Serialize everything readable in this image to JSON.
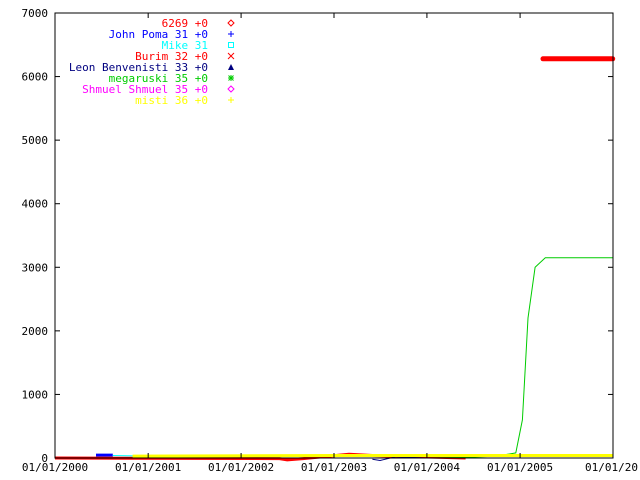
{
  "chart_data": {
    "type": "line",
    "title": "",
    "xlabel": "",
    "ylabel": "",
    "ylim": [
      0,
      7000
    ],
    "yticks": [
      0,
      1000,
      2000,
      3000,
      4000,
      5000,
      6000,
      7000
    ],
    "ytick_labels": [
      "0",
      "1000",
      "2000",
      "3000",
      "4000",
      "5000",
      "6000",
      "7000"
    ],
    "xlim": [
      "2000-01-01",
      "2006-01-01"
    ],
    "xticks": [
      "2000-01-01",
      "2001-01-01",
      "2002-01-01",
      "2003-01-01",
      "2004-01-01",
      "2005-01-01",
      "2006-01-01"
    ],
    "xtick_labels": [
      "01/01/2000",
      "01/01/2001",
      "01/01/2002",
      "01/01/2003",
      "01/01/2004",
      "01/01/2005",
      "01/01/20"
    ],
    "grid": false,
    "legend_position": "top-left",
    "series": [
      {
        "name": "6269",
        "legend_label": "6269 +0",
        "color": "#ff0000",
        "marker": "diamond",
        "x": [
          "2005-04-01",
          "2005-12-31"
        ],
        "y": [
          6280,
          6280
        ]
      },
      {
        "name": "John Poma",
        "legend_label": "John Poma 31 +0",
        "color": "#0000ff",
        "marker": "plus",
        "x": [
          "2000-06-10",
          "2000-08-15"
        ],
        "y": [
          45,
          45
        ]
      },
      {
        "name": "Mike",
        "legend_label": "Mike 31",
        "color": "#00ffff",
        "marker": "square",
        "x": [
          "2000-08-15",
          "2000-10-15",
          "2001-01-01"
        ],
        "y": [
          40,
          35,
          30
        ]
      },
      {
        "name": "Burim",
        "legend_label": "Burim 32 +0",
        "color": "#ff0000",
        "marker": "cross",
        "x": [
          "2000-01-01",
          "2002-06-01",
          "2002-07-01",
          "2002-09-01",
          "2003-03-01",
          "2003-06-01",
          "2004-06-01"
        ],
        "y": [
          0,
          -10,
          -30,
          -10,
          60,
          40,
          0
        ]
      },
      {
        "name": "Leon Benvenisti",
        "legend_label": "Leon Benvenisti 33 +0",
        "color": "#000080",
        "marker": "triangle",
        "x": [
          "2003-06-01",
          "2003-07-01",
          "2003-09-01",
          "2003-12-31"
        ],
        "y": [
          -20,
          -40,
          20,
          0
        ]
      },
      {
        "name": "megaruski",
        "legend_label": "megaruski 35 +0",
        "color": "#00cc00",
        "marker": "asterisk",
        "x": [
          "2001-01-01",
          "2004-01-01",
          "2004-06-01",
          "2004-10-01",
          "2004-12-15",
          "2005-01-10",
          "2005-02-01",
          "2005-03-01",
          "2005-04-10",
          "2005-12-31"
        ],
        "y": [
          0,
          0,
          10,
          30,
          80,
          600,
          2200,
          3000,
          3150,
          3150
        ]
      },
      {
        "name": "Shmuel Shmuel",
        "legend_label": "Shmuel Shmuel 35 +0",
        "color": "#ff00ff",
        "marker": "diamond-open",
        "x": [
          "2000-01-01",
          "2001-06-01"
        ],
        "y": [
          0,
          0
        ]
      },
      {
        "name": "misti",
        "legend_label": "misti 36 +0",
        "color": "#ffff00",
        "marker": "plus",
        "x": [
          "2000-11-01",
          "2003-01-01",
          "2005-12-31"
        ],
        "y": [
          30,
          40,
          40
        ]
      }
    ]
  }
}
